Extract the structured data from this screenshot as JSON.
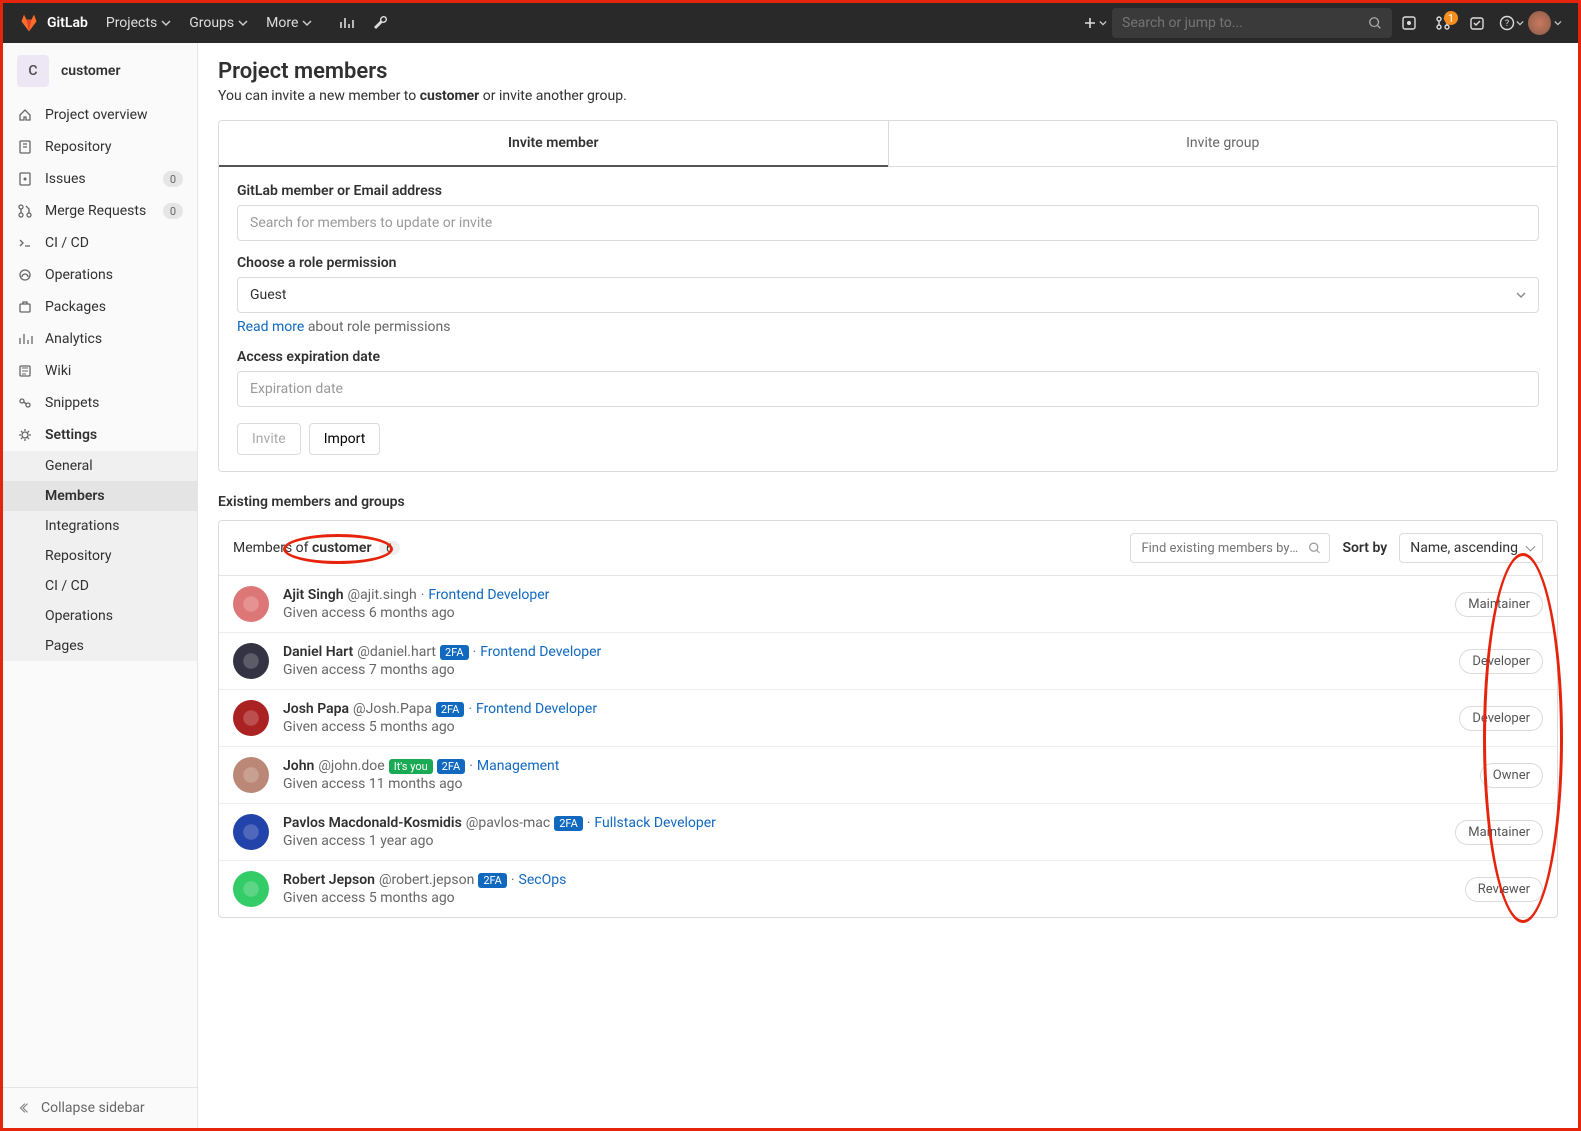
{
  "topbar": {
    "brand": "GitLab",
    "nav": [
      "Projects",
      "Groups",
      "More"
    ],
    "search_placeholder": "Search or jump to...",
    "mr_count": "1"
  },
  "sidebar": {
    "project_initial": "C",
    "project_name": "customer",
    "items": [
      {
        "label": "Project overview"
      },
      {
        "label": "Repository"
      },
      {
        "label": "Issues",
        "badge": "0"
      },
      {
        "label": "Merge Requests",
        "badge": "0"
      },
      {
        "label": "CI / CD"
      },
      {
        "label": "Operations"
      },
      {
        "label": "Packages"
      },
      {
        "label": "Analytics"
      },
      {
        "label": "Wiki"
      },
      {
        "label": "Snippets"
      },
      {
        "label": "Settings"
      }
    ],
    "settings_sub": [
      "General",
      "Members",
      "Integrations",
      "Repository",
      "CI / CD",
      "Operations",
      "Pages"
    ],
    "collapse": "Collapse sidebar"
  },
  "page": {
    "title": "Project members",
    "intro_pre": "You can invite a new member to ",
    "intro_proj": "customer",
    "intro_post": " or invite another group.",
    "tab_member": "Invite member",
    "tab_group": "Invite group",
    "lbl_member": "GitLab member or Email address",
    "ph_member": "Search for members to update or invite",
    "lbl_role": "Choose a role permission",
    "role_value": "Guest",
    "help_link": "Read more",
    "help_text": " about role permissions",
    "lbl_exp": "Access expiration date",
    "ph_exp": "Expiration date",
    "btn_invite": "Invite",
    "btn_import": "Import",
    "existing_title": "Existing members and groups",
    "members_of_pre": "Members of ",
    "members_of_proj": "customer",
    "members_count": "6",
    "find_ph": "Find existing members by name",
    "sort_label": "Sort by",
    "sort_value": "Name, ascending"
  },
  "members": [
    {
      "name": "Ajit Singh",
      "user": "@ajit.singh",
      "tags": [],
      "role": "Frontend Developer",
      "access": "Given access 6 months ago",
      "perm": "Maintainer",
      "av": "#d77"
    },
    {
      "name": "Daniel Hart",
      "user": "@daniel.hart",
      "tags": [
        "2FA"
      ],
      "role": "Frontend Developer",
      "access": "Given access 7 months ago",
      "perm": "Developer",
      "av": "#334"
    },
    {
      "name": "Josh Papa",
      "user": "@Josh.Papa",
      "tags": [
        "2FA"
      ],
      "role": "Frontend Developer",
      "access": "Given access 5 months ago",
      "perm": "Developer",
      "av": "#a22"
    },
    {
      "name": "John",
      "user": "@john.doe",
      "tags": [
        "It's you",
        "2FA"
      ],
      "role": "Management",
      "access": "Given access 11 months ago",
      "perm": "Owner",
      "av": "#b87"
    },
    {
      "name": "Pavlos Macdonald-Kosmidis",
      "user": "@pavlos-mac",
      "tags": [
        "2FA"
      ],
      "role": "Fullstack Developer",
      "access": "Given access 1 year ago",
      "perm": "Maintainer",
      "av": "#24a"
    },
    {
      "name": "Robert Jepson",
      "user": "@robert.jepson",
      "tags": [
        "2FA"
      ],
      "role": "SecOps",
      "access": "Given access 5 months ago",
      "perm": "Reviewer",
      "av": "#3c6"
    }
  ]
}
